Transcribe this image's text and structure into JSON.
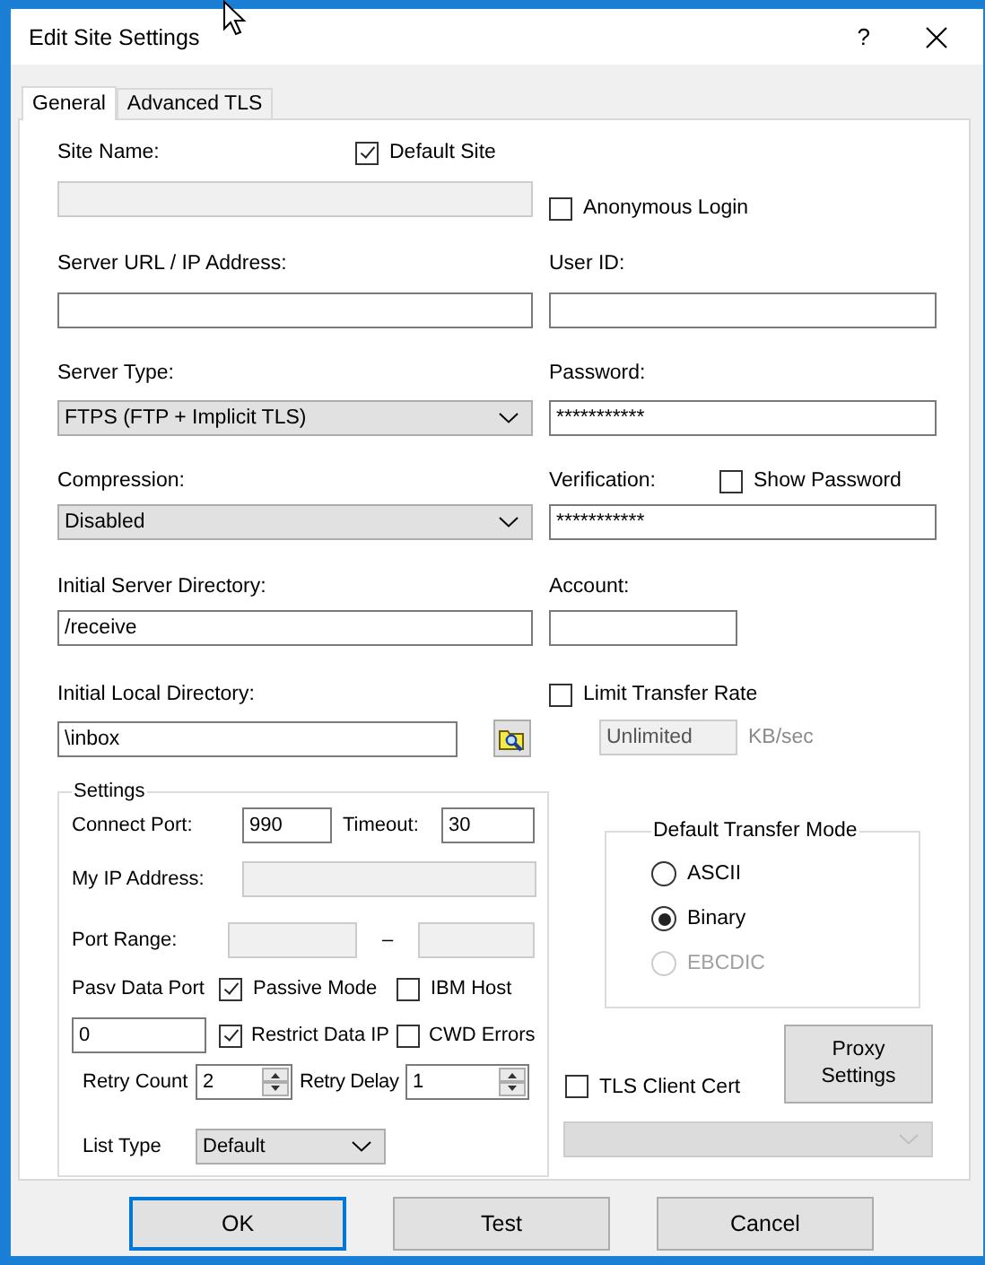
{
  "window": {
    "title": "Edit Site Settings",
    "help": "?"
  },
  "tabs": [
    {
      "label": "General",
      "selected": true
    },
    {
      "label": "Advanced TLS",
      "selected": false
    }
  ],
  "site_name": {
    "label": "Site Name:",
    "disabled": true
  },
  "default_site": {
    "label": "Default Site",
    "checked": true
  },
  "anonymous_login": {
    "label": "Anonymous Login",
    "checked": false
  },
  "server_url": {
    "label": "Server URL / IP Address:"
  },
  "user_id": {
    "label": "User ID:"
  },
  "server_type": {
    "label": "Server Type:",
    "value": "FTPS (FTP + Implicit TLS)"
  },
  "password": {
    "label": "Password:",
    "value": "***********"
  },
  "compression": {
    "label": "Compression:",
    "value": "Disabled"
  },
  "verification": {
    "label": "Verification:",
    "value": "***********"
  },
  "show_password": {
    "label": "Show Password",
    "checked": false
  },
  "initial_server_directory": {
    "label": "Initial Server Directory:",
    "value": "/receive"
  },
  "account": {
    "label": "Account:"
  },
  "initial_local_directory": {
    "label": "Initial Local Directory:",
    "value": "\\inbox"
  },
  "limit_transfer_rate": {
    "label": "Limit Transfer Rate",
    "checked": false
  },
  "rate": {
    "value": "Unlimited",
    "unit": "KB/sec",
    "disabled": true
  },
  "settings": {
    "title": "Settings",
    "connect_port": {
      "label": "Connect Port:",
      "value": "990"
    },
    "timeout": {
      "label": "Timeout:",
      "value": "30"
    },
    "my_ip_address": {
      "label": "My IP Address:",
      "disabled": true
    },
    "port_range": {
      "label": "Port Range:",
      "separator": "–",
      "disabled": true
    },
    "pasv_data_port": {
      "label": "Pasv Data Port",
      "value": "0"
    },
    "passive_mode": {
      "label": "Passive Mode",
      "checked": true
    },
    "ibm_host": {
      "label": "IBM Host",
      "checked": false
    },
    "restrict_data_ip": {
      "label": "Restrict Data IP",
      "checked": true
    },
    "cwd_errors": {
      "label": "CWD Errors",
      "checked": false
    },
    "retry_count": {
      "label": "Retry Count",
      "value": "2"
    },
    "retry_delay": {
      "label": "Retry Delay",
      "value": "1"
    },
    "list_type": {
      "label": "List Type",
      "value": "Default"
    }
  },
  "default_transfer_mode": {
    "title": "Default Transfer Mode",
    "options": [
      {
        "label": "ASCII",
        "selected": false,
        "disabled": false
      },
      {
        "label": "Binary",
        "selected": true,
        "disabled": false
      },
      {
        "label": "EBCDIC",
        "selected": false,
        "disabled": true
      }
    ]
  },
  "proxy_settings": {
    "label": "Proxy Settings"
  },
  "tls_client_cert": {
    "label": "TLS Client Cert",
    "checked": false
  },
  "tls_certificate": {
    "disabled": true
  },
  "buttons": [
    {
      "label": "OK",
      "default": true
    },
    {
      "label": "Test",
      "default": false
    },
    {
      "label": "Cancel",
      "default": false
    }
  ]
}
